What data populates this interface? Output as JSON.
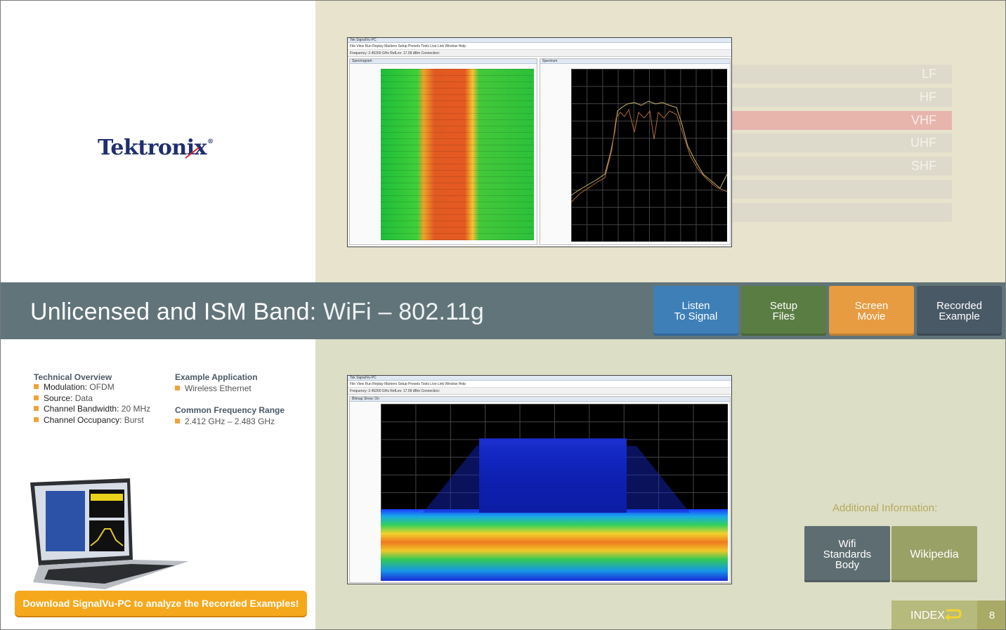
{
  "logo": {
    "name": "Tektronix",
    "reg": "®"
  },
  "bands": [
    {
      "label": "LF",
      "active": false
    },
    {
      "label": "HF",
      "active": false
    },
    {
      "label": "VHF",
      "active": true
    },
    {
      "label": "UHF",
      "active": false
    },
    {
      "label": "SHF",
      "active": false
    },
    {
      "label": "",
      "active": false
    },
    {
      "label": "",
      "active": false
    }
  ],
  "banner": {
    "title_main": "Unlicensed and ISM Band:",
    "title_sub": "WiFi – 802.11g"
  },
  "nav": {
    "listen_line1": "Listen",
    "listen_line2": "To Signal",
    "setup_line1": "Setup",
    "setup_line2": "Files",
    "movie_line1": "Screen",
    "movie_line2": "Movie",
    "recorded_line1": "Recorded",
    "recorded_line2": "Example"
  },
  "screenshot_top": {
    "window_title": "Tek SignalVu-PC",
    "menu": "File   View   Run   Replay   Markers   Setup   Presets   Tools   Live Link   Window   Help",
    "toolbar": "Frequency: 2.45200 GHz     RefLev: 17.09 dBm     Connection:",
    "left_panel_title": "Spectrogram",
    "right_panel_title": "Spectrum"
  },
  "screenshot_bot": {
    "window_title": "Tek SignalVu-PC",
    "menu": "File   View   Run   Replay   Markers   Setup   Presets   Tools   Live Link   Window   Help",
    "toolbar": "Frequency: 2.45200 GHz     RefLev: 17.09 dBm     Connection:",
    "panel_title": "Bitmap   Show: On"
  },
  "technical": {
    "heading": "Technical Overview",
    "items": [
      {
        "label": "Modulation:",
        "value": "OFDM"
      },
      {
        "label": "Source:",
        "value": "Data"
      },
      {
        "label": "Channel Bandwidth:",
        "value": "20 MHz"
      },
      {
        "label": "Channel Occupancy:",
        "value": "Burst"
      }
    ]
  },
  "example_app": {
    "heading": "Example Application",
    "value": "Wireless Ethernet"
  },
  "freq_range": {
    "heading": "Common Frequency Range",
    "value": "2.412 GHz – 2.483 GHz"
  },
  "download": {
    "label": "Download SignalVu-PC to analyze the Recorded Examples!"
  },
  "additional": {
    "heading": "Additional Information:",
    "wifi_line1": "Wifi",
    "wifi_line2": "Standards",
    "wifi_line3": "Body",
    "wiki": "Wikipedia"
  },
  "footer": {
    "index": "INDEX",
    "page": "8"
  },
  "colors": {
    "banner": "#617479",
    "listen": "#3e7fb8",
    "setup": "#5a7d44",
    "movie": "#e79c42",
    "recorded": "#4a5966",
    "download": "#f6a81c"
  }
}
